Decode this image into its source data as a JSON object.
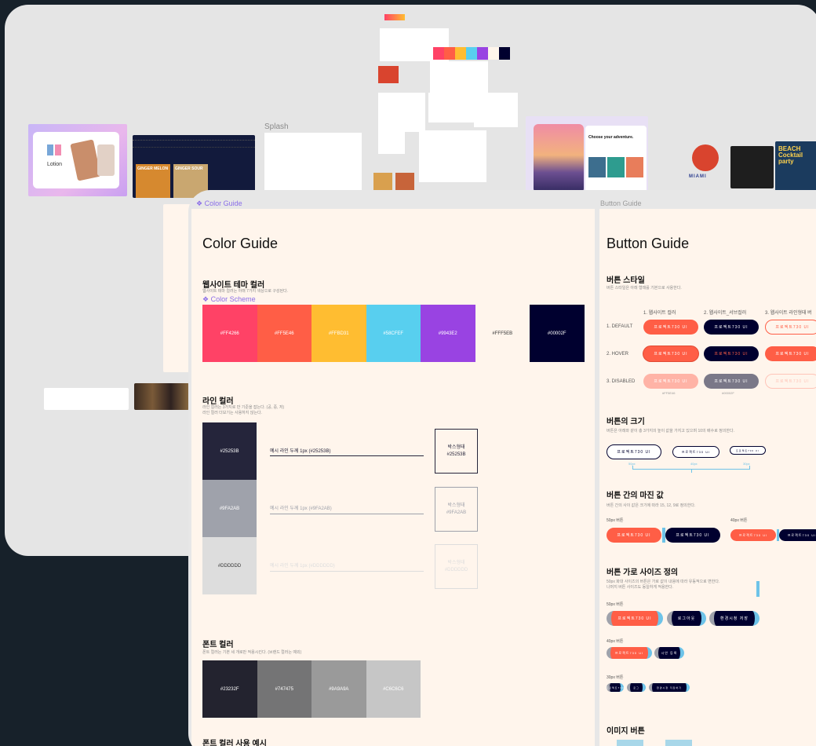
{
  "canvas": {
    "splash_label": "Splash",
    "thumb_texts": {
      "lotion": "Lotion",
      "ginger1": "GINGER MELON",
      "ginger2": "GINGER SOUR",
      "adventure": "Choose your adventure.",
      "miami": "MIAMI",
      "beach": "BEACH Cocktail party"
    },
    "swatch_strip": [
      "#FF4266",
      "#FF5E46",
      "#FFBD31",
      "#58CFEF",
      "#9943E2",
      "#FFF5EB",
      "#00002F"
    ]
  },
  "frames": {
    "color_guide_label": "❖ Color Guide",
    "button_guide_label": "Button Guide"
  },
  "color_guide": {
    "title": "Color Guide",
    "theme": {
      "heading": "웹사이트 테마 컬러",
      "desc": "웹사이트 테마 컬러는 아래 7가지 색상으로 구성된다.",
      "scheme_tag": "❖ Color Scheme",
      "swatches": [
        {
          "hex": "#FF4266",
          "label": "#FF4266"
        },
        {
          "hex": "#FF5E46",
          "label": "#FF5E46"
        },
        {
          "hex": "#FFBD31",
          "label": "#FFBD31"
        },
        {
          "hex": "#58CFEF",
          "label": "#58CFEF"
        },
        {
          "hex": "#9943E2",
          "label": "#9943E2"
        },
        {
          "hex": "#FFF5EB",
          "label": "#FFF5EB"
        },
        {
          "hex": "#00002F",
          "label": "#00002F"
        }
      ]
    },
    "line": {
      "heading": "라인 컬러",
      "desc1": "라인 컬러는 3가지로 만 기준을 잡는다. (공, 중, 저)",
      "desc2": "라인 컬러 더보기는 사용하지 않는다.",
      "rows": [
        {
          "hex": "#25253B",
          "label": "#25253B",
          "example": "예시 라인 두께 1px (#25253B)",
          "box": "박스형태\n#25253B"
        },
        {
          "hex": "#9FA2AB",
          "label": "#9FA2AB",
          "example": "예시 라인 두께 1px (#9FA2AB)",
          "box": "박스형태\n#9FA2AB"
        },
        {
          "hex": "#DDDDDD",
          "label": "#DDDDDD",
          "example": "예시 라인 두께 1px (#DDDDDD)",
          "box": "박스형태\n#DDDDDD"
        }
      ]
    },
    "font": {
      "heading": "폰트 컬러",
      "desc": "폰트 컬러는 기본 세 개로만 적용시킨다. (브랜드 컬러는 예외)",
      "swatches": [
        {
          "hex": "#23232F",
          "label": "#23232F"
        },
        {
          "hex": "#747475",
          "label": "#747475"
        },
        {
          "hex": "#9A9A9A",
          "label": "#9A9A9A"
        },
        {
          "hex": "#C6C6C6",
          "label": "#C6C6C6"
        }
      ],
      "usage_heading": "폰트 컬러 사용 예시"
    }
  },
  "button_guide": {
    "title": "Button Guide",
    "style": {
      "heading": "버튼 스타일",
      "desc": "버튼 스타일은 아래 형태를 기본으로 사용한다.",
      "columns": [
        "1. 웹사이트 컬러",
        "2. 웹사이트_서브컬러",
        "3. 웹사이트 라인형태 버"
      ],
      "rows": [
        "1. DEFAULT",
        "2. HOVER",
        "3. DISABLED"
      ],
      "button_text": "프로젝트730 UI",
      "notes": [
        "#FF5E46",
        "#00002F"
      ]
    },
    "size": {
      "heading": "버튼의 크기",
      "desc": "버튼은 아래와 같이 총 3가지의 높이 값을 가지고 있으며 10의 배수로 정의한다.",
      "labels": [
        "50px",
        "40px",
        "30px"
      ]
    },
    "margin": {
      "heading": "버튼 간의 마진 값",
      "desc": "버튼 간의 사이 값은 크기에 따라 15, 12, 9로 정의한다.",
      "labels": [
        "50px 버튼",
        "40px 버튼"
      ]
    },
    "width": {
      "heading": "버튼 가로 사이즈 정의",
      "desc1": "50px 화대 사이즈의 버튼은 가로 값이 내용에 따라 유동적으로 변한다.",
      "desc2": "나머지 버튼 사이즈도 동일하게 적용한다.",
      "labels": [
        "50px 버튼",
        "40px 버튼",
        "30px 버튼"
      ],
      "texts": [
        "프로젝트730 UI",
        "로그아웃",
        "환경시청 저장",
        "프로젝트730 UI",
        "시안 등록",
        "프로젝트730",
        "로그",
        "환경시청 저장하기"
      ]
    },
    "image": {
      "heading": "이미지 버튼"
    }
  }
}
